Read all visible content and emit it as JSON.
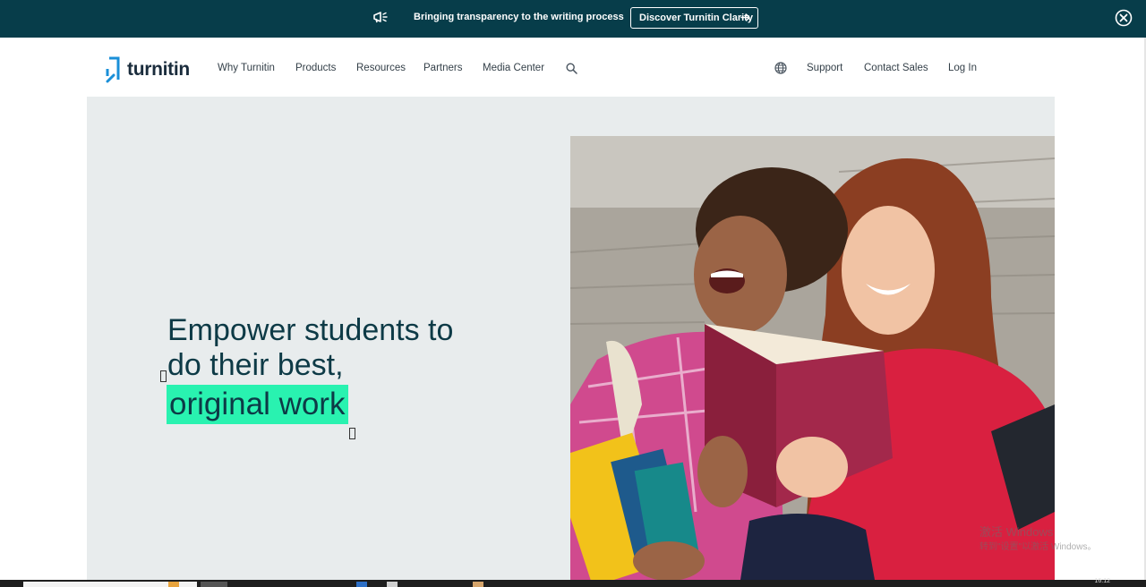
{
  "announcement": {
    "message": "Bringing transparency to the writing process",
    "cta_label": "Discover Turnitin Clarity",
    "icon": "megaphone-icon",
    "close_icon": "close-circle-icon"
  },
  "nav": {
    "logo_text": "turnitin",
    "links": [
      "Why Turnitin",
      "Products",
      "Resources",
      "Partners",
      "Media Center"
    ],
    "right_links": [
      "Support",
      "Contact Sales",
      "Log In"
    ]
  },
  "hero": {
    "headline_line1": "Empower students to",
    "headline_line2": "do their best,",
    "headline_highlight": "original work",
    "highlight_color": "#29f2b0"
  },
  "watermark": {
    "line1": "激活 Windows",
    "line2": "转到\"设置\"以激活 Windows。"
  },
  "taskbar": {
    "clock": "16:12"
  },
  "colors": {
    "banner_bg": "#073d4a",
    "hero_bg": "#e8eced",
    "headline": "#0d3a46",
    "logo_blue": "#1a8fd8"
  }
}
